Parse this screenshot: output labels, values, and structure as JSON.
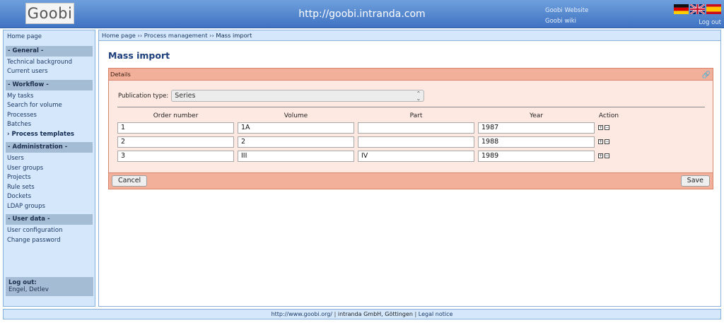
{
  "header": {
    "logo_text": "Goobi",
    "site_url": "http://goobi.intranda.com",
    "links": [
      "Goobi Website",
      "Goobi wiki"
    ],
    "flags": [
      "flag-de-icon",
      "flag-uk-icon",
      "flag-es-icon"
    ],
    "logout": "Log out"
  },
  "sidebar": {
    "home": "Home page",
    "sections": [
      {
        "title": "- General -",
        "items": [
          "Technical background",
          "Current users"
        ]
      },
      {
        "title": "- Workflow -",
        "items": [
          "My tasks",
          "Search for volume",
          "Processes",
          "Batches",
          "› Process templates"
        ]
      },
      {
        "title": "- Administration -",
        "items": [
          "Users",
          "User groups",
          "Projects",
          "Rule sets",
          "Dockets",
          "LDAP groups"
        ]
      },
      {
        "title": "- User data -",
        "items": [
          "User configuration",
          "Change password"
        ]
      }
    ],
    "active_item": "› Process templates",
    "logout_label": "Log out:",
    "logout_user": "Engel, Detlev"
  },
  "breadcrumb": {
    "items": [
      "Home page",
      "Process management"
    ],
    "separator": "››",
    "current": "Mass import"
  },
  "page": {
    "title": "Mass import",
    "panel_title": "Details",
    "publication_type_label": "Publication type:",
    "publication_type_value": "Series",
    "columns": [
      "Order number",
      "Volume",
      "Part",
      "Year",
      "Action"
    ],
    "rows": [
      {
        "order": "1",
        "volume": "1A",
        "part": "",
        "year": "1987"
      },
      {
        "order": "2",
        "volume": "2",
        "part": "",
        "year": "1988"
      },
      {
        "order": "3",
        "volume": "III",
        "part": "IV",
        "year": "1989"
      }
    ],
    "action_icons": [
      "plus-icon",
      "minus-icon"
    ],
    "cancel_label": "Cancel",
    "save_label": "Save"
  },
  "footer": {
    "url": "http://www.goobi.org/",
    "company": "intranda GmbH, Göttingen",
    "legal": "Legal notice",
    "separator": "|"
  },
  "colors": {
    "header": "#4a7fcc",
    "sidebar_bg": "#d4e7fb",
    "section_bg": "#a4bdd5",
    "panel_bg": "#fde9e2",
    "panel_head": "#f2b09a",
    "title": "#1b3d7a"
  }
}
